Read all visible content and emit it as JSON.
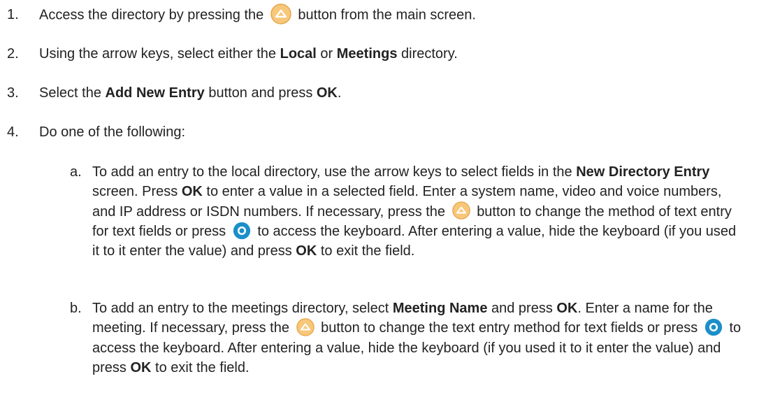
{
  "steps": [
    {
      "num": "1.",
      "pre": "Access the directory by pressing the",
      "post": "button from the main screen.",
      "icon": "up-arrow-button-icon"
    },
    {
      "num": "2.",
      "t1": "Using the arrow keys, select either the ",
      "b1": "Local",
      "t2": " or ",
      "b2": "Meetings",
      "t3": " directory."
    },
    {
      "num": "3.",
      "t1": "Select the ",
      "b1": "Add New Entry",
      "t2": " button and press ",
      "b2": "OK",
      "t3": "."
    },
    {
      "num": "4.",
      "t1": "Do one of the following:"
    }
  ],
  "sub_a": {
    "letter": "a.",
    "t1": "To add an entry to the local directory, use the arrow keys to select fields in the ",
    "b1": "New Directory Entry",
    "t2": " screen. Press ",
    "b2": "OK",
    "t3": " to enter a value in a selected field. Enter a system name, video and voice numbers, and IP address or ISDN numbers. If necessary, press the",
    "t4": "button to change the method of text entry for text fields or press",
    "t5": "to access the keyboard. After entering a value, hide the keyboard (if you used it to it enter the value) and press ",
    "b3": "OK",
    "t6": " to exit the field."
  },
  "sub_b": {
    "letter": "b.",
    "t1": "To add an entry to the meetings directory, select ",
    "b1": "Meeting Name",
    "t2": " and press ",
    "b2": "OK",
    "t3": ". Enter a name for the meeting. If necessary, press the",
    "t4": "button to change the text entry method for text fields or press",
    "t5": "to access the keyboard. After entering a value, hide the keyboard (if you used it to it enter the value) and press ",
    "b3": "OK",
    "t6": " to exit the field."
  },
  "icons": {
    "up_button": {
      "name": "up-arrow-button-icon",
      "fill": "#f7c77a",
      "border": "#e6a64a",
      "arrow": "#ffffff"
    },
    "keyboard_button": {
      "name": "keyboard-button-icon",
      "fill": "#1b8fc9",
      "dot": "#ffffff"
    }
  }
}
